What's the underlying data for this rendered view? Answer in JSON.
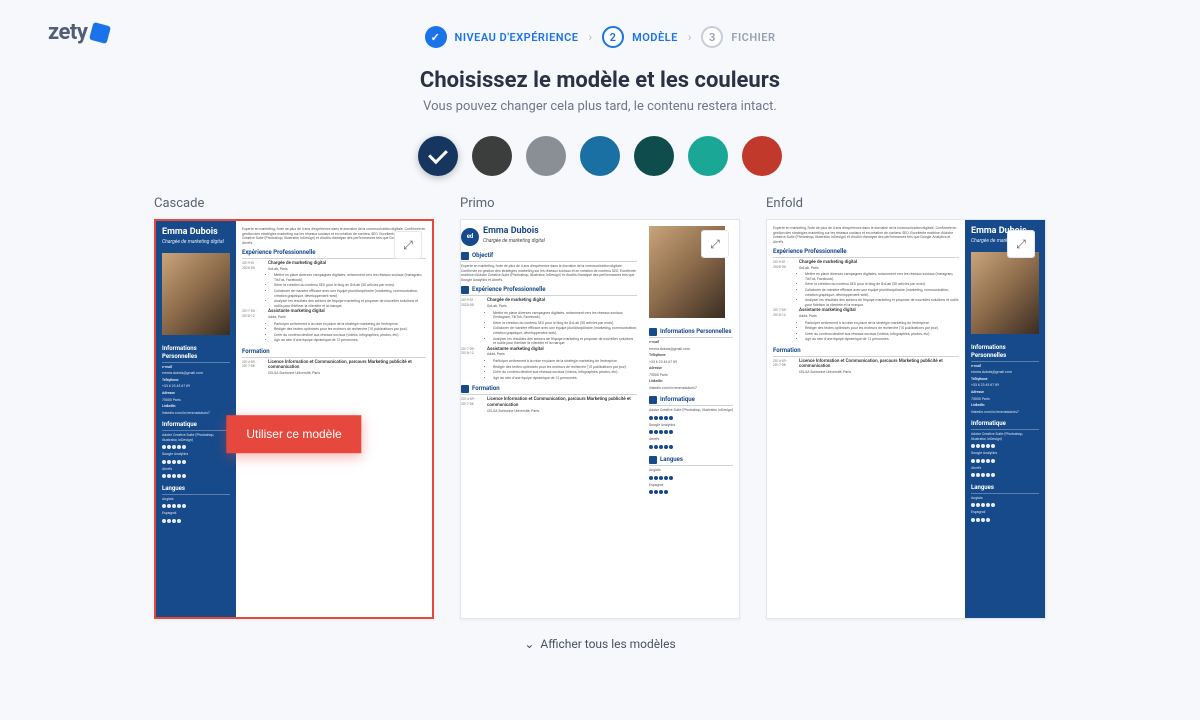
{
  "brand": {
    "name": "zety"
  },
  "stepper": {
    "step1": {
      "label": "NIVEAU D'EXPÉRIENCE"
    },
    "step2": {
      "num": "2",
      "label": "MODÈLE"
    },
    "step3": {
      "num": "3",
      "label": "FICHIER"
    }
  },
  "heading": {
    "title": "Choisissez le modèle et les couleurs",
    "subtitle": "Vous pouvez changer cela plus tard, le contenu restera intact."
  },
  "colors": [
    {
      "hex": "#16365f",
      "selected": true
    },
    {
      "hex": "#3b3e3c",
      "selected": false
    },
    {
      "hex": "#8a8f95",
      "selected": false
    },
    {
      "hex": "#1a6fa3",
      "selected": false
    },
    {
      "hex": "#0f4c4c",
      "selected": false
    },
    {
      "hex": "#1aa795",
      "selected": false
    },
    {
      "hex": "#c0392b",
      "selected": false
    }
  ],
  "templates": [
    {
      "name": "Cascade",
      "selected": true
    },
    {
      "name": "Primo",
      "selected": false
    },
    {
      "name": "Enfold",
      "selected": false
    }
  ],
  "actions": {
    "use_template": "Utiliser ce modèle",
    "show_all": "Afficher tous les modèles"
  },
  "resume": {
    "name": "Emma Dubois",
    "title": "Chargée de marketing digital",
    "badge": "ed",
    "summary": "Experte en marketing, forte de plus de 4 ans d'expérience dans le domaine de la communication digitale. Confirmée en gestion des stratégies marketing sur les réseaux sociaux et en création de contenu SEO. Excellente maîtrise d'Adobe Creative Suite (Photoshop, Illustrator, InDesign) et d'outils d'analyse des performances tels que Google Analytics et Ahrefs.",
    "sections": {
      "experience": "Expérience Professionnelle",
      "objective": "Objectif",
      "info": "Informations Personnelles",
      "skills": "Informatique",
      "languages": "Langues",
      "education": "Formation"
    },
    "job1": {
      "title": "Chargée de marketing digital",
      "company": "GoLab, Paris",
      "dates": "2019-01 - 2020-05",
      "bullets": [
        "Mettre en place diverses campagnes digitales, notamment vers les réseaux sociaux (Instagram, TikTok, Facebook).",
        "Gérer la création du contenu SEO pour le blog de GoLab (30 articles par mois).",
        "Collaborer de manière efficace avec une équipe pluridisciplinaire (marketing, communication, création graphique, développement web).",
        "Analyser les résultats des actions de l'équipe marketing et proposer de nouvelles solutions et outils pour fidéliser la clientèle et la marque."
      ]
    },
    "job2": {
      "title": "Assistante marketing digital",
      "company": "Addd, Paris",
      "dates": "2017-05 - 2018-12",
      "bullets": [
        "Participer activement à la mise en place de la stratégie marketing de l'entreprise.",
        "Rédiger des textes optimisés pour les moteurs de recherche (10 publications par jour).",
        "Créer du contenu destiné aux réseaux sociaux (vidéos, infographies, photos, etc).",
        "Agir au sein d'une équipe dynamique de 12 personnes."
      ]
    },
    "edu": {
      "title": "Licence Information et Communication, parcours Marketing publicité et communication",
      "school": "CELSA Sorbonne Université, Paris",
      "dates": "2014-09 - 2017-06"
    },
    "contact": {
      "email_label": "e-mail",
      "email": "emma.dubois@gmail.com",
      "phone_label": "Téléphone",
      "phone": "+33 6 23 45 67 89",
      "address_label": "Adresse",
      "address": "75000 Paris",
      "linkedin_label": "LinkedIn",
      "linkedin": "linkedin.com/in/emmadubois7"
    },
    "skills": [
      "Adobe Creative Suite (Photoshop, Illustrator, InDesign)",
      "Google Analytics",
      "Ahrefs"
    ],
    "languages": [
      "Anglais",
      "Espagnol"
    ]
  }
}
